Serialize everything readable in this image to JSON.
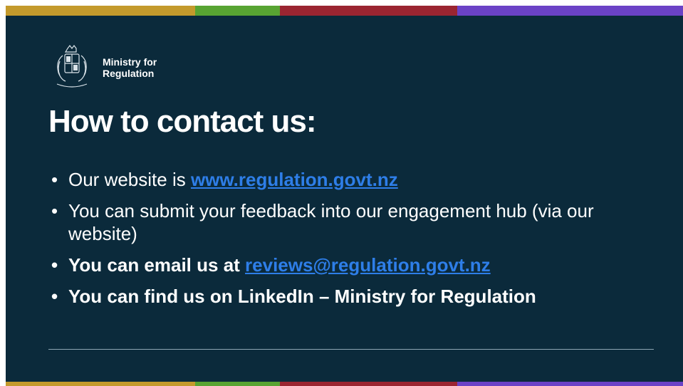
{
  "colors": {
    "background": "#0b2a3b",
    "link": "#2e7ee8",
    "stripe": [
      "#c49a2c",
      "#58a432",
      "#9b2531",
      "#6b42c6"
    ]
  },
  "logo": {
    "line1": "Ministry for",
    "line2": "Regulation",
    "icon": "coat-of-arms-icon"
  },
  "title": "How to contact us:",
  "bullets": [
    {
      "text": "Our website is ",
      "link": "www.regulation.govt.nz"
    },
    {
      "text": "You can submit your feedback into our engagement hub (via our website)"
    },
    {
      "text": "You can email us at ",
      "link": "reviews@regulation.govt.nz"
    },
    {
      "text": "You can find us on LinkedIn – Ministry for Regulation"
    }
  ]
}
